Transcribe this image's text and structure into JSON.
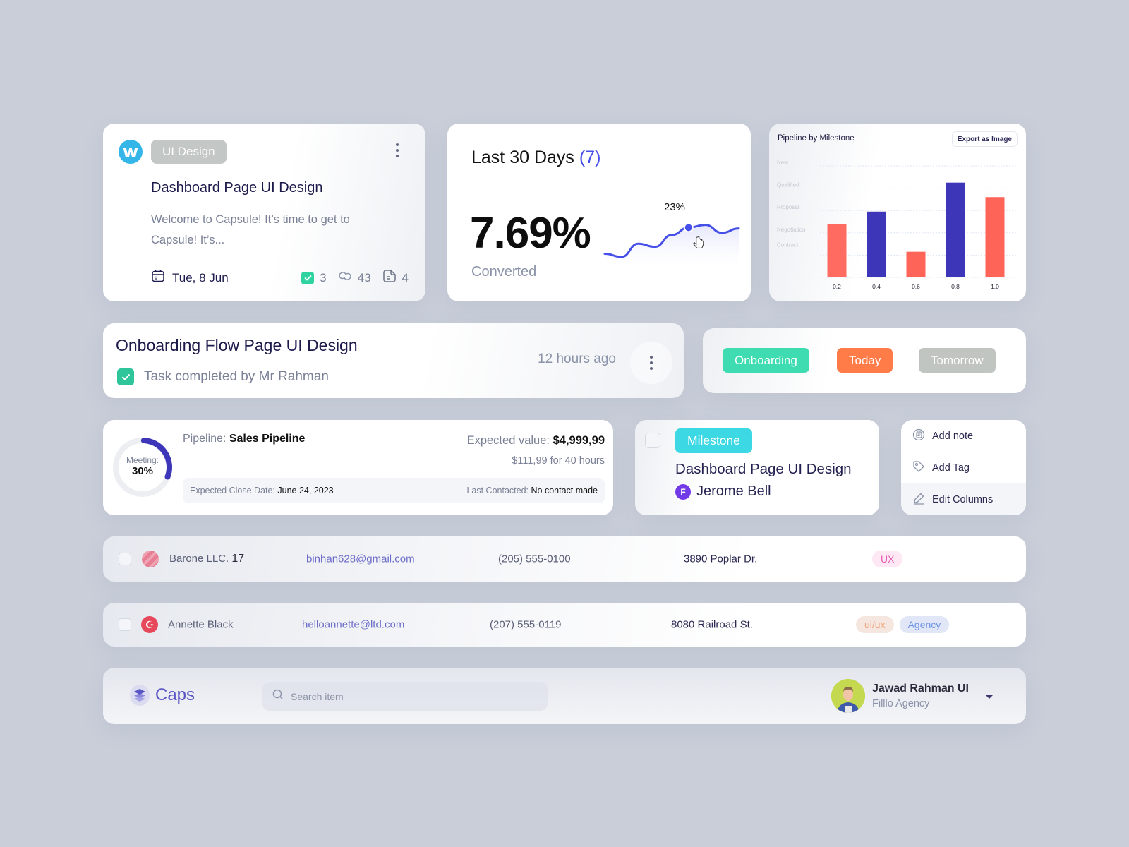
{
  "task_card": {
    "tag": "UI Design",
    "title": "Dashboard Page UI Design",
    "description": "Welcome to Capsule! It’s time to get to Capsule! It’s...",
    "date": "Tue, 8 Jun",
    "checks_count": "3",
    "links_count": "43",
    "files_count": "4",
    "logo_letter": "w"
  },
  "stats_card": {
    "title": "Last 30 Days",
    "count": "(7)",
    "value": "7.69%",
    "label": "Converted",
    "highlight_label": "23%",
    "sparkline": [
      0.12,
      0.05,
      0.35,
      0.28,
      0.55,
      0.72,
      0.78,
      0.6,
      0.7
    ],
    "highlight_index": 5
  },
  "chart_data": {
    "type": "bar",
    "title": "Pipeline by Milestone",
    "export_label": "Export as Image",
    "categories": [
      "0.2",
      "0.4",
      "0.6",
      "0.8",
      "1.0"
    ],
    "values": [
      2.4,
      2.95,
      1.15,
      4.25,
      3.6
    ],
    "bar_colors": [
      "#ff6b61",
      "#3d36b8",
      "#ff6459",
      "#3d36b8",
      "#ff6459"
    ],
    "y_tick_labels": [
      "New",
      "Qualified",
      "Proposal",
      "Negotiation",
      "Contract"
    ],
    "ylim": [
      0,
      5
    ],
    "grid": true,
    "xlabel": "",
    "ylabel": ""
  },
  "activity_card": {
    "title": "Onboarding Flow Page UI Design",
    "subtitle": "Task completed by Mr Rahman",
    "time": "12 hours ago"
  },
  "chips": [
    {
      "label": "Onboarding",
      "color": "#3fdcb2"
    },
    {
      "label": "Today",
      "color": "#ff7b48"
    },
    {
      "label": "Tomorrow",
      "color": "#c0c5c2"
    }
  ],
  "deal_card": {
    "ring_label": "Meeting:",
    "ring_value": "30%",
    "ring_progress": 0.3,
    "pipeline_label": "Pipeline:",
    "pipeline_value": "Sales Pipeline",
    "expected_label": "Expected value:",
    "expected_value": "$4,999,99",
    "rate": "$111,99 for 40 hours",
    "close_label": "Expected Close Date:",
    "close_value": "June 24, 2023",
    "contact_label": "Last Contacted:",
    "contact_value": "No contact made"
  },
  "milestone_card": {
    "tag": "Milestone",
    "title": "Dashboard Page UI Design",
    "person": "Jerome Bell",
    "person_initial": "F"
  },
  "menu": {
    "items": [
      {
        "label": "Add note",
        "icon": "note-icon"
      },
      {
        "label": "Add Tag",
        "icon": "tag-icon"
      },
      {
        "label": "Edit Columns",
        "icon": "pencil-icon"
      }
    ]
  },
  "rows": [
    {
      "name": "Barone LLC.",
      "name_suffix": "17",
      "email": "binhan628@gmail.com",
      "phone": "(205) 555-0100",
      "address": "3890 Poplar Dr.",
      "tags": [
        {
          "label": "UX",
          "bg": "#fde8f3",
          "fg": "#e85bb4"
        }
      ]
    },
    {
      "name": "Annette Black",
      "name_suffix": "",
      "email": "helloannette@ltd.com",
      "phone": "(207) 555-0119",
      "address": "8080 Railroad St.",
      "tags": [
        {
          "label": "ui/ux",
          "bg": "#f5e6df",
          "fg": "#efa57d"
        },
        {
          "label": "Agency",
          "bg": "#e1e7f7",
          "fg": "#6f93e8"
        }
      ]
    }
  ],
  "header": {
    "brand": "Caps",
    "search_placeholder": "Search item",
    "user_name": "Jawad Rahman UI",
    "user_org": "Filllo Agency"
  }
}
